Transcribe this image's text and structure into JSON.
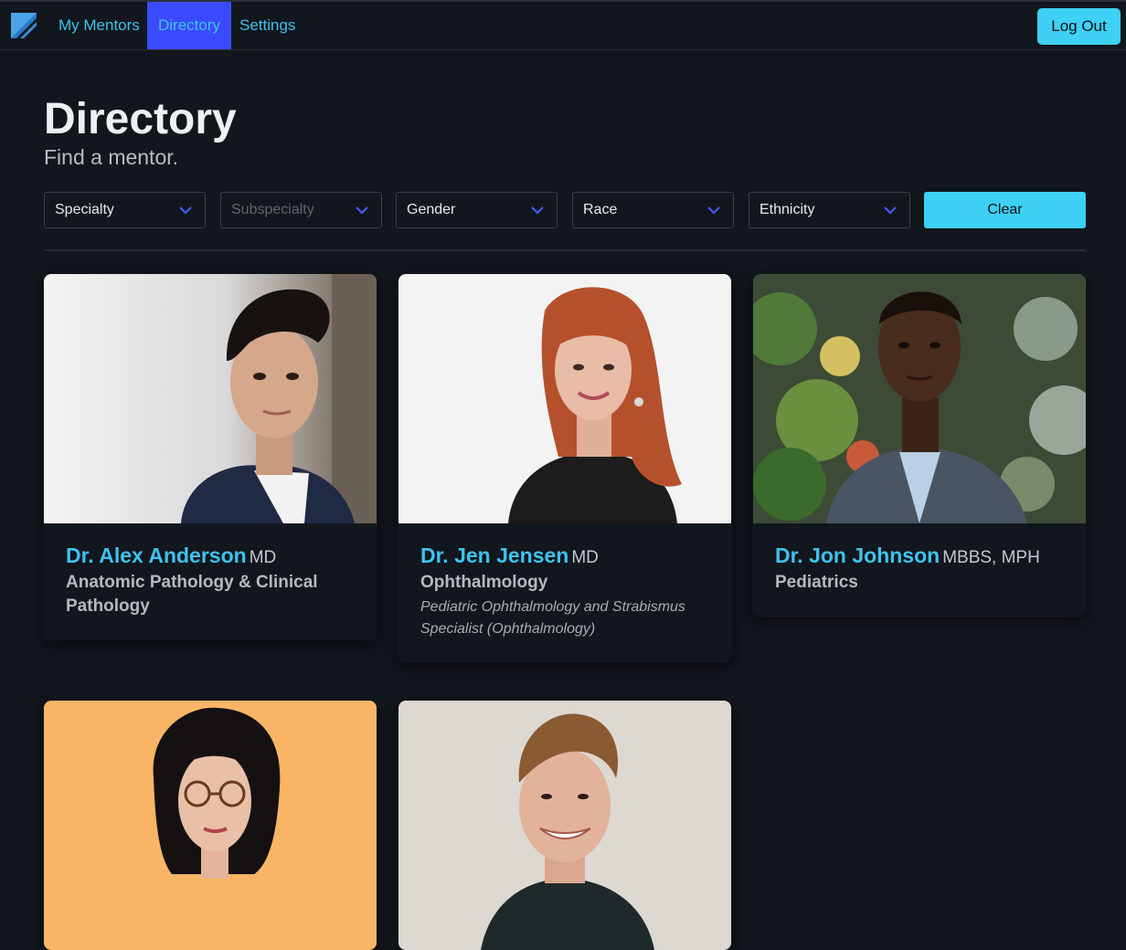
{
  "nav": {
    "items": [
      {
        "label": "My Mentors"
      },
      {
        "label": "Directory"
      },
      {
        "label": "Settings"
      }
    ],
    "logout_label": "Log Out"
  },
  "header": {
    "title": "Directory",
    "subtitle": "Find a mentor."
  },
  "filters": {
    "selects": [
      {
        "label": "Specialty",
        "disabled": false
      },
      {
        "label": "Subspecialty",
        "disabled": true
      },
      {
        "label": "Gender",
        "disabled": false
      },
      {
        "label": "Race",
        "disabled": false
      },
      {
        "label": "Ethnicity",
        "disabled": false
      }
    ],
    "clear_label": "Clear"
  },
  "mentors": [
    {
      "name": "Dr. Alex Anderson",
      "credentials": "MD",
      "specialty": "Anatomic Pathology & Clinical Pathology",
      "subspecialty": ""
    },
    {
      "name": "Dr. Jen Jensen",
      "credentials": "MD",
      "specialty": "Ophthalmology",
      "subspecialty": "Pediatric Ophthalmology and Strabismus Specialist (Ophthalmology)"
    },
    {
      "name": "Dr. Jon Johnson",
      "credentials": "MBBS, MPH",
      "specialty": "Pediatrics",
      "subspecialty": ""
    },
    {
      "name": "",
      "credentials": "",
      "specialty": "",
      "subspecialty": ""
    },
    {
      "name": "",
      "credentials": "",
      "specialty": "",
      "subspecialty": ""
    }
  ],
  "colors": {
    "background": "#12161d",
    "accent": "#3ec3ee",
    "button": "#3ed0f5",
    "active_nav": "#3a4bff"
  }
}
